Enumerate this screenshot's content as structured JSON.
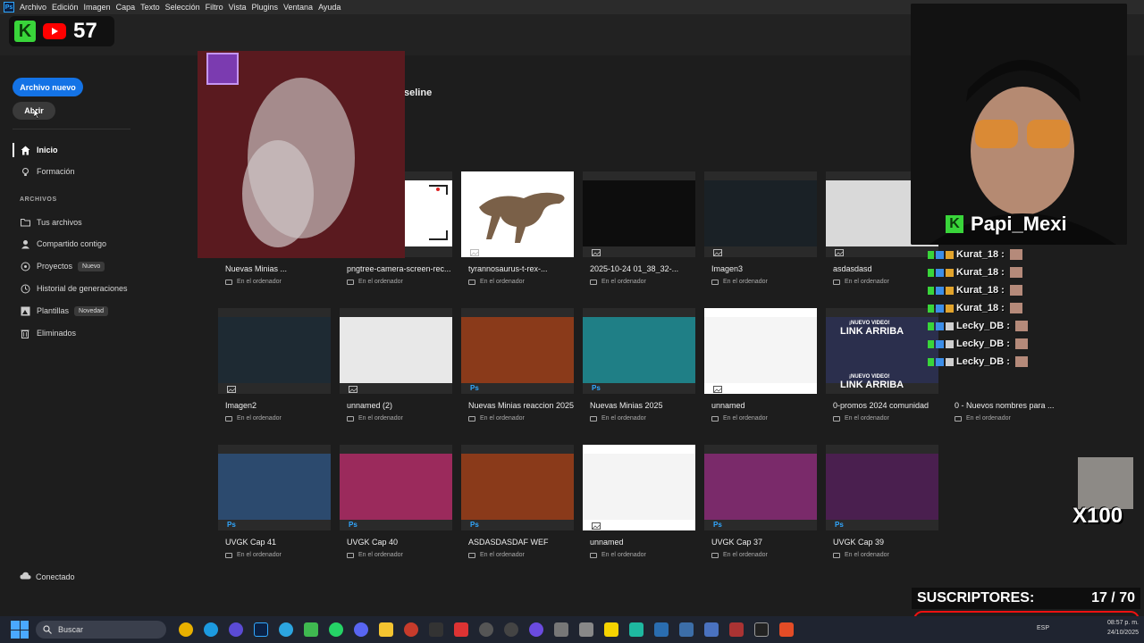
{
  "app": {
    "menu": [
      "Archivo",
      "Edición",
      "Imagen",
      "Capa",
      "Texto",
      "Selección",
      "Filtro",
      "Vista",
      "Plugins",
      "Ventana",
      "Ayuda"
    ]
  },
  "sidebar": {
    "new_file": "Archivo nuevo",
    "open": "Abrir",
    "nav": [
      {
        "label": "Inicio",
        "icon": "home-icon"
      },
      {
        "label": "Formación",
        "icon": "lightbulb-icon"
      }
    ],
    "section": "ARCHIVOS",
    "files": [
      {
        "label": "Tus archivos",
        "icon": "folder-icon",
        "badge": ""
      },
      {
        "label": "Compartido contigo",
        "icon": "people-icon",
        "badge": ""
      },
      {
        "label": "Proyectos",
        "icon": "projects-icon",
        "badge": "Nuevo"
      },
      {
        "label": "Historial de generaciones",
        "icon": "history-icon",
        "badge": ""
      },
      {
        "label": "Plantillas",
        "icon": "templates-icon",
        "badge": "Novedad"
      },
      {
        "label": "Eliminados",
        "icon": "trash-icon",
        "badge": ""
      }
    ],
    "status": "Conectado"
  },
  "main": {
    "heading_fragment": "seline",
    "location_label": "En el ordenador",
    "rows": [
      [
        {
          "name": "Nuevas Minias ...",
          "type": "image"
        },
        {
          "name": "pngtree-camera-screen-rec...",
          "type": "image"
        },
        {
          "name": "tyrannosaurus-t-rex-...",
          "type": "image"
        },
        {
          "name": "2025-10-24 01_38_32-...",
          "type": "image"
        },
        {
          "name": "Imagen3",
          "type": "image"
        },
        {
          "name": "asdasdasd",
          "type": "image"
        }
      ],
      [
        {
          "name": "Imagen2",
          "type": "image"
        },
        {
          "name": "unnamed (2)",
          "type": "image"
        },
        {
          "name": "Nuevas Minias reaccion 2025",
          "type": "ps"
        },
        {
          "name": "Nuevas Minias 2025",
          "type": "ps"
        },
        {
          "name": "unnamed",
          "type": "image"
        },
        {
          "name": "0-promos 2024 comunidad",
          "type": "image"
        },
        {
          "name": "0 - Nuevos nombres para ...",
          "type": "image"
        }
      ],
      [
        {
          "name": "UVGK Cap 41",
          "type": "ps"
        },
        {
          "name": "UVGK Cap 40",
          "type": "ps"
        },
        {
          "name": "ASDASDASDAF WEF",
          "type": "ps"
        },
        {
          "name": "unnamed",
          "type": "image"
        },
        {
          "name": "UVGK Cap 37",
          "type": "ps"
        },
        {
          "name": "UVGK Cap 39",
          "type": "ps"
        }
      ]
    ],
    "ps_label": "Ps"
  },
  "overlay": {
    "brand_letter": "K",
    "subscriber_count_badge": "57",
    "streamer": "Papi_Mexi",
    "chat": [
      {
        "user": "Kurat_18 :"
      },
      {
        "user": "Kurat_18 :"
      },
      {
        "user": "Kurat_18 :"
      },
      {
        "user": "Kurat_18 :"
      },
      {
        "user": "Lecky_DB :"
      },
      {
        "user": "Lecky_DB :"
      },
      {
        "user": "Lecky_DB :"
      }
    ],
    "promo": {
      "top": "¡NUEVO VIDEO!",
      "link": "LINK ARRIBA"
    },
    "x100": "X100",
    "subs_label": "SUSCRIPTORES:",
    "subs_value": "17  / 70",
    "subs_progress": 0.243
  },
  "taskbar": {
    "search": "Buscar",
    "lang": "ESP",
    "time": "08:57 p. m.",
    "date": "24/10/2025"
  },
  "colors": {
    "accent": "#1473e6",
    "ps_blue": "#31a8ff",
    "brand_green": "#39d53a",
    "alert_red": "#e11111"
  }
}
